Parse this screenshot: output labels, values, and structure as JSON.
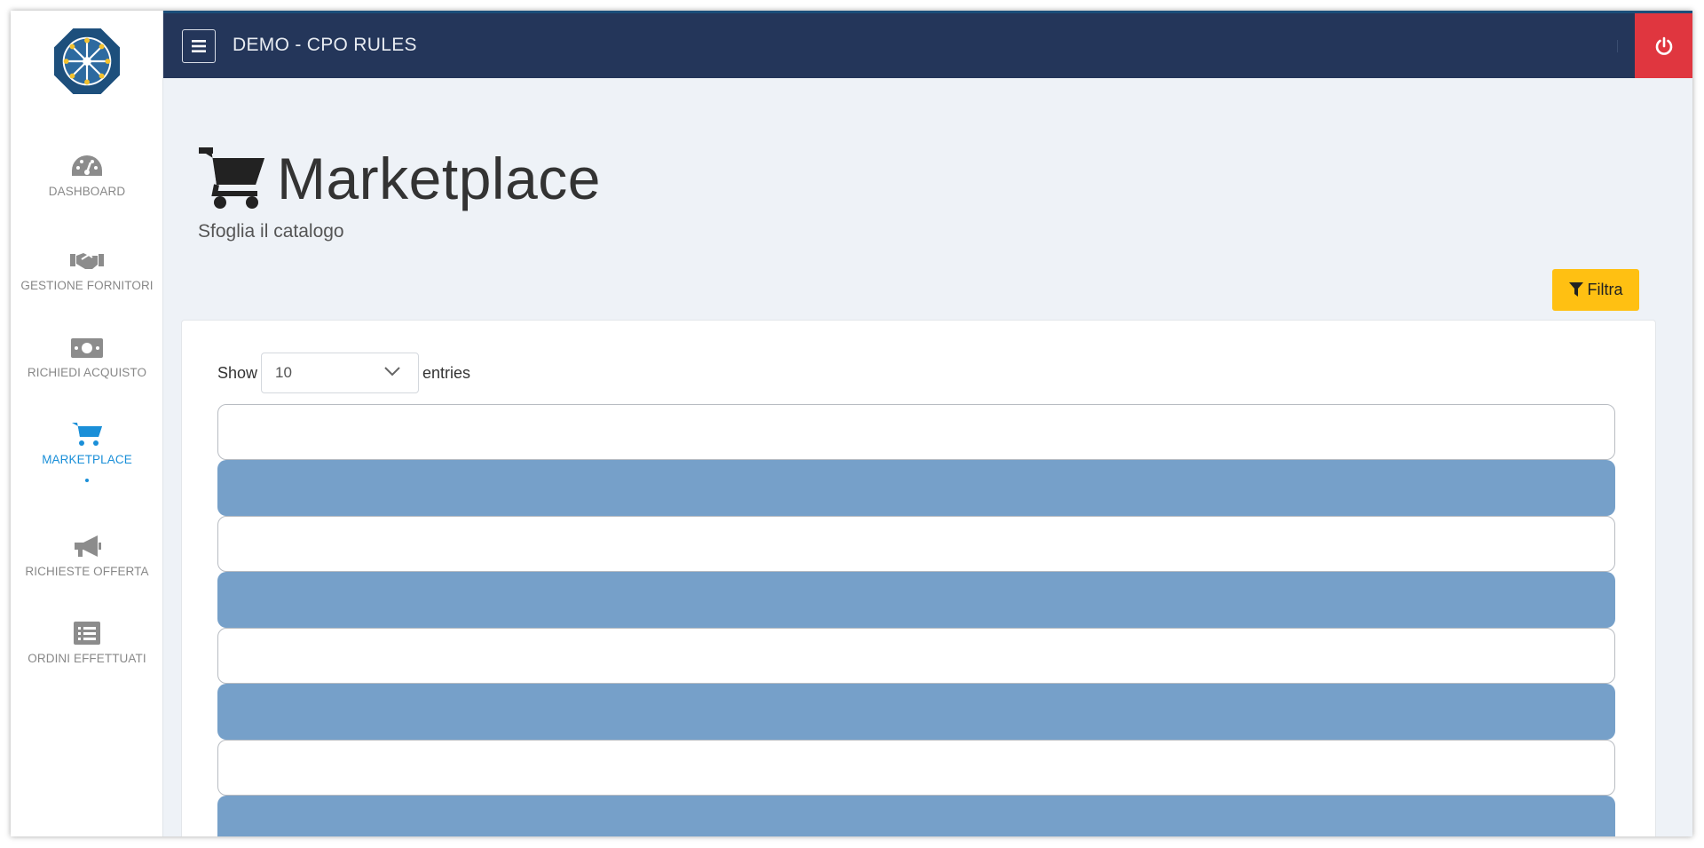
{
  "app": {
    "title": "DEMO - CPO RULES"
  },
  "sidebar": {
    "items": [
      {
        "label": "DASHBOARD",
        "icon": "dashboard-icon",
        "active": false
      },
      {
        "label": "GESTIONE FORNITORI",
        "icon": "handshake-icon",
        "active": false
      },
      {
        "label": "RICHIEDI ACQUISTO",
        "icon": "money-icon",
        "active": false
      },
      {
        "label": "MARKETPLACE",
        "icon": "cart-icon",
        "active": true
      },
      {
        "label": "RICHIESTE OFFERTA",
        "icon": "megaphone-icon",
        "active": false
      },
      {
        "label": "ORDINI EFFETTUATI",
        "icon": "list-icon",
        "active": false
      }
    ]
  },
  "page": {
    "title": "Marketplace",
    "subtitle": "Sfoglia il catalogo",
    "filter_label": "Filtra"
  },
  "table": {
    "show_label": "Show",
    "entries_label": "entries",
    "page_size": "10",
    "row_pattern": [
      "white",
      "blue",
      "white",
      "blue",
      "white",
      "blue",
      "white",
      "blue"
    ]
  },
  "colors": {
    "topbar": "#24365a",
    "power": "#e0363f",
    "accent": "#1a8fd8",
    "filter": "#ffc012",
    "row_blue": "#76a0c9"
  }
}
